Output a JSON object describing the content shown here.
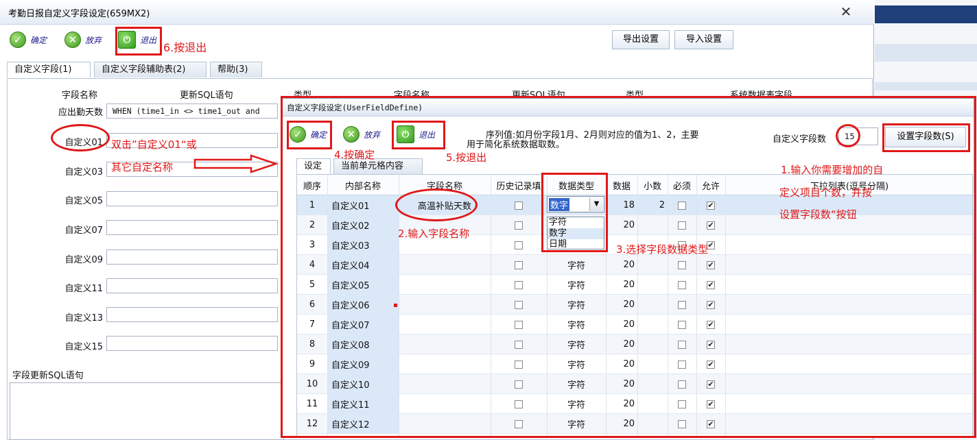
{
  "outer": {
    "title": "考勤日报自定义字段设定(659MX2)",
    "close": "✕",
    "toolbar": {
      "ok": "确定",
      "cancel": "放弃",
      "exit": "退出"
    },
    "export_btn": "导出设置",
    "import_btn": "导入设置",
    "tabs": [
      "自定义字段(1)",
      "自定义字段辅助表(2)",
      "帮助(3)"
    ],
    "col_field_name": "字段名称",
    "col_sql": "更新SQL语句",
    "col_type": "类型",
    "col_field_name2": "字段名称",
    "col_sql2": "更新SQL语句",
    "col_type2": "类型",
    "col_sysfield": "系统数据表字段",
    "rows": [
      {
        "label": "应出勤天数",
        "value": "WHEN (time1_in <> time1_out and"
      },
      {
        "label": "自定义01",
        "value": ""
      },
      {
        "label": "自定义03",
        "value": ""
      },
      {
        "label": "自定义05",
        "value": ""
      },
      {
        "label": "自定义07",
        "value": ""
      },
      {
        "label": "自定义09",
        "value": ""
      },
      {
        "label": "自定义11",
        "value": ""
      },
      {
        "label": "自定义13",
        "value": ""
      },
      {
        "label": "自定义15",
        "value": ""
      }
    ],
    "sql_label": "字段更新SQL语句"
  },
  "inner": {
    "title": "自定义字段设定(UserFieldDefine)",
    "toolbar": {
      "ok": "确定",
      "cancel": "放弃",
      "exit": "退出"
    },
    "hint_line1": "序列值:如月份字段1月、2月则对应的值为1、2，主要",
    "hint_line2": "用于简化系统数据取数。",
    "count_label": "自定义字段数",
    "count_value": "15",
    "set_count_btn": "设置字段数(S)",
    "tabs": [
      "设定",
      "当前单元格内容"
    ],
    "headers": [
      "顺序",
      "内部名称",
      "字段名称",
      "历史记录填",
      "数据类型",
      "数据",
      "小数",
      "必须",
      "允许",
      "下拉列表(逗号分隔)"
    ],
    "rows": [
      {
        "seq": "1",
        "name": "自定义01",
        "field": "高温补贴天数",
        "type": "数字",
        "len": "18",
        "dec": "2",
        "allow": true
      },
      {
        "seq": "2",
        "name": "自定义02",
        "field": "",
        "type": "",
        "len": "20",
        "dec": "",
        "allow": true
      },
      {
        "seq": "3",
        "name": "自定义03",
        "field": "",
        "type": "",
        "len": "",
        "dec": "",
        "allow": true
      },
      {
        "seq": "4",
        "name": "自定义04",
        "field": "",
        "type": "字符",
        "len": "20",
        "dec": "",
        "allow": true
      },
      {
        "seq": "5",
        "name": "自定义05",
        "field": "",
        "type": "字符",
        "len": "20",
        "dec": "",
        "allow": true
      },
      {
        "seq": "6",
        "name": "自定义06",
        "field": "",
        "type": "字符",
        "len": "20",
        "dec": "",
        "allow": true
      },
      {
        "seq": "7",
        "name": "自定义07",
        "field": "",
        "type": "字符",
        "len": "20",
        "dec": "",
        "allow": true
      },
      {
        "seq": "8",
        "name": "自定义08",
        "field": "",
        "type": "字符",
        "len": "20",
        "dec": "",
        "allow": true
      },
      {
        "seq": "9",
        "name": "自定义09",
        "field": "",
        "type": "字符",
        "len": "20",
        "dec": "",
        "allow": true
      },
      {
        "seq": "10",
        "name": "自定义10",
        "field": "",
        "type": "字符",
        "len": "20",
        "dec": "",
        "allow": true
      },
      {
        "seq": "11",
        "name": "自定义11",
        "field": "",
        "type": "字符",
        "len": "20",
        "dec": "",
        "allow": true
      },
      {
        "seq": "12",
        "name": "自定义12",
        "field": "",
        "type": "字符",
        "len": "20",
        "dec": "",
        "allow": true
      }
    ],
    "dropdown_value": "数字",
    "dropdown_options": [
      "字符",
      "数字",
      "日期"
    ]
  },
  "annotations": {
    "a6": "6.按退出",
    "a_dbl1": "双击”自定义01“或",
    "a_dbl2": "其它自定名称",
    "a4": "4.按确定",
    "a5": "5.按退出",
    "a2": "2.输入字段名称",
    "a3": "3.选择字段数据类型",
    "a1_1": "1.输入你需要增加的自",
    "a1_2": "定义项目个数，并按",
    "a1_3": "设置字段数“按钮"
  }
}
